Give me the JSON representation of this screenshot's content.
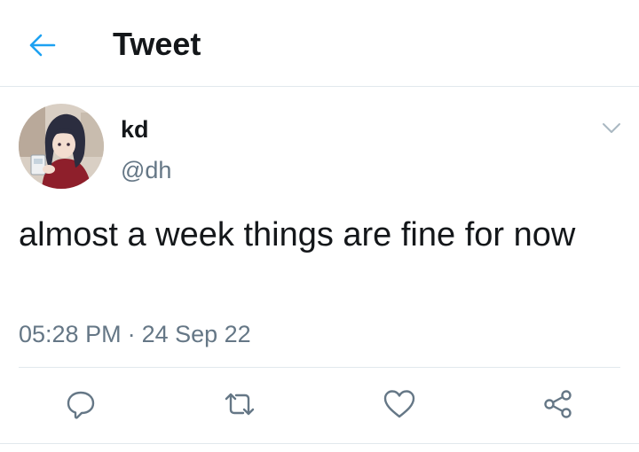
{
  "header": {
    "title": "Tweet",
    "back_icon": "arrow-left-icon"
  },
  "tweet": {
    "display_name": "kd",
    "handle": "@dh",
    "text": "almost a week things are fine for now",
    "time": "05:28 PM",
    "separator": "·",
    "date": "24 Sep 22"
  },
  "actions": [
    {
      "icon": "reply-icon"
    },
    {
      "icon": "retweet-icon"
    },
    {
      "icon": "like-icon"
    },
    {
      "icon": "share-icon"
    }
  ],
  "colors": {
    "accent": "#1da1f2",
    "text_primary": "#14171a",
    "text_secondary": "#657786",
    "icon_gray": "#657786",
    "divider": "#e1e8ed"
  }
}
